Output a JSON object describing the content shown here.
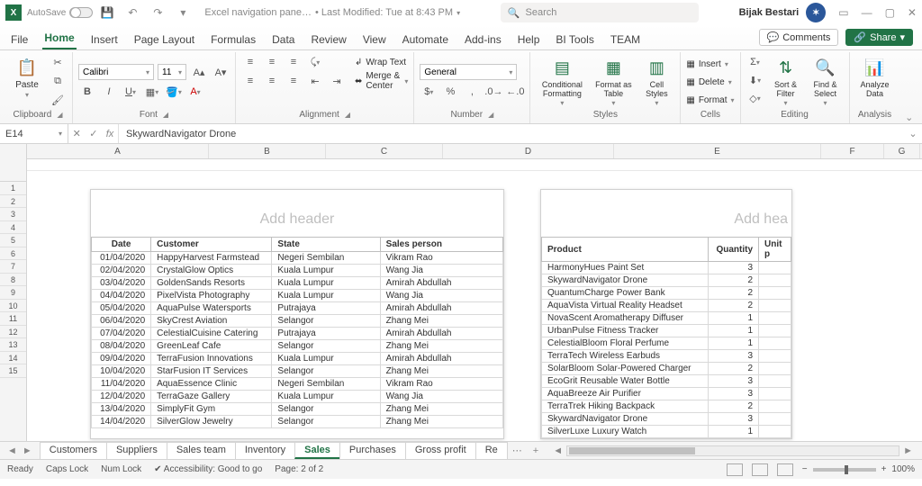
{
  "titlebar": {
    "autosave": "AutoSave",
    "docname": "Excel navigation pane…",
    "modified": "• Last Modified: Tue at 8:43 PM",
    "search_placeholder": "Search",
    "user": "Bijak Bestari"
  },
  "tabs": [
    "File",
    "Home",
    "Insert",
    "Page Layout",
    "Formulas",
    "Data",
    "Review",
    "View",
    "Automate",
    "Add-ins",
    "Help",
    "BI Tools",
    "TEAM"
  ],
  "active_tab": "Home",
  "comments_btn": "Comments",
  "share_btn": "Share",
  "ribbon": {
    "clipboard": {
      "label": "Clipboard",
      "paste": "Paste"
    },
    "font": {
      "label": "Font",
      "name": "Calibri",
      "size": "11"
    },
    "alignment": {
      "label": "Alignment",
      "wrap": "Wrap Text",
      "merge": "Merge & Center"
    },
    "number": {
      "label": "Number",
      "format": "General"
    },
    "styles": {
      "label": "Styles",
      "cond": "Conditional Formatting",
      "table": "Format as Table",
      "cell": "Cell Styles"
    },
    "cells": {
      "label": "Cells",
      "insert": "Insert",
      "delete": "Delete",
      "format": "Format"
    },
    "editing": {
      "label": "Editing",
      "sort": "Sort & Filter",
      "find": "Find & Select"
    },
    "analysis": {
      "label": "Analysis",
      "analyze": "Analyze Data"
    }
  },
  "namebox": "E14",
  "formula": "SkywardNavigator Drone",
  "cols_left": {
    "A": "",
    "B": "Date",
    "C": "Customer",
    "D": "State",
    "E": "Sales person"
  },
  "cols_right": {
    "E2": "Product",
    "F": "Quantity",
    "G": "Unit p"
  },
  "colheads": [
    "A",
    "B",
    "C",
    "D"
  ],
  "colheads_r": [
    "E",
    "F",
    "G"
  ],
  "addheader": "Add header",
  "addheader_r": "Add hea",
  "left_table": {
    "headers": [
      "Date",
      "Customer",
      "State",
      "Sales person"
    ],
    "rows": [
      [
        "01/04/2020",
        "HappyHarvest Farmstead",
        "Negeri Sembilan",
        "Vikram Rao"
      ],
      [
        "02/04/2020",
        "CrystalGlow Optics",
        "Kuala Lumpur",
        "Wang Jia"
      ],
      [
        "03/04/2020",
        "GoldenSands Resorts",
        "Kuala Lumpur",
        "Amirah Abdullah"
      ],
      [
        "04/04/2020",
        "PixelVista Photography",
        "Kuala Lumpur",
        "Wang Jia"
      ],
      [
        "05/04/2020",
        "AquaPulse Watersports",
        "Putrajaya",
        "Amirah Abdullah"
      ],
      [
        "06/04/2020",
        "SkyCrest Aviation",
        "Selangor",
        "Zhang Mei"
      ],
      [
        "07/04/2020",
        "CelestialCuisine Catering",
        "Putrajaya",
        "Amirah Abdullah"
      ],
      [
        "08/04/2020",
        "GreenLeaf Cafe",
        "Selangor",
        "Zhang Mei"
      ],
      [
        "09/04/2020",
        "TerraFusion Innovations",
        "Kuala Lumpur",
        "Amirah Abdullah"
      ],
      [
        "10/04/2020",
        "StarFusion IT Services",
        "Selangor",
        "Zhang Mei"
      ],
      [
        "11/04/2020",
        "AquaEssence Clinic",
        "Negeri Sembilan",
        "Vikram Rao"
      ],
      [
        "12/04/2020",
        "TerraGaze Gallery",
        "Kuala Lumpur",
        "Wang Jia"
      ],
      [
        "13/04/2020",
        "SimplyFit Gym",
        "Selangor",
        "Zhang Mei"
      ],
      [
        "14/04/2020",
        "SilverGlow Jewelry",
        "Selangor",
        "Zhang Mei"
      ]
    ]
  },
  "right_table": {
    "headers": [
      "Product",
      "Quantity",
      "Unit p"
    ],
    "rows": [
      [
        "HarmonyHues Paint Set",
        "3",
        ""
      ],
      [
        "SkywardNavigator Drone",
        "2",
        ""
      ],
      [
        "QuantumCharge Power Bank",
        "2",
        ""
      ],
      [
        "AquaVista Virtual Reality Headset",
        "2",
        ""
      ],
      [
        "NovaScent Aromatherapy Diffuser",
        "1",
        ""
      ],
      [
        "UrbanPulse Fitness Tracker",
        "1",
        ""
      ],
      [
        "CelestialBloom Floral Perfume",
        "1",
        ""
      ],
      [
        "TerraTech Wireless Earbuds",
        "3",
        ""
      ],
      [
        "SolarBloom Solar-Powered Charger",
        "2",
        ""
      ],
      [
        "EcoGrit Reusable Water Bottle",
        "3",
        ""
      ],
      [
        "AquaBreeze Air Purifier",
        "3",
        ""
      ],
      [
        "TerraTrek Hiking Backpack",
        "2",
        ""
      ],
      [
        "SkywardNavigator Drone",
        "3",
        ""
      ],
      [
        "SilverLuxe Luxury Watch",
        "1",
        ""
      ]
    ]
  },
  "row_numbers": [
    "1",
    "2",
    "3",
    "4",
    "5",
    "6",
    "7",
    "8",
    "9",
    "10",
    "11",
    "12",
    "13",
    "14",
    "15"
  ],
  "sheet_tabs": [
    "Customers",
    "Suppliers",
    "Sales team",
    "Inventory",
    "Sales",
    "Purchases",
    "Gross profit",
    "Re"
  ],
  "active_sheet": "Sales",
  "status": {
    "ready": "Ready",
    "caps": "Caps Lock",
    "num": "Num Lock",
    "access": "Accessibility: Good to go",
    "page": "Page: 2 of 2",
    "zoom": "100%"
  }
}
